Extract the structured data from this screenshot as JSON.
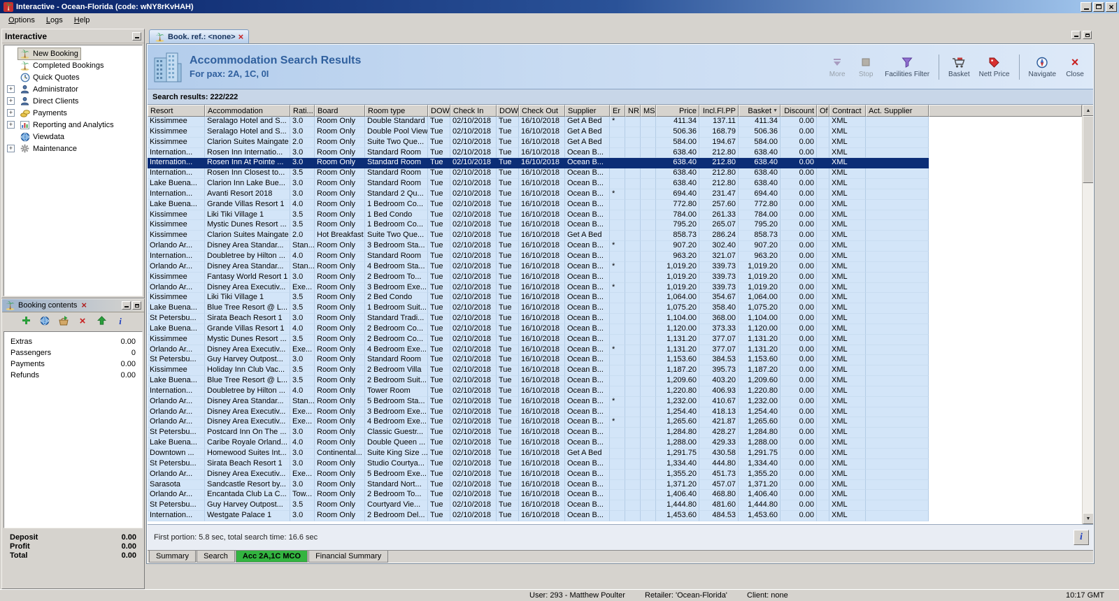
{
  "window": {
    "title": "Interactive - Ocean-Florida (code: wNY8rKvHAH)",
    "time": "10:17 GMT",
    "status_user": "User: 293 - Matthew Poulter",
    "status_retailer": "Retailer: 'Ocean-Florida'",
    "status_client": "Client: none"
  },
  "colors": {
    "selected_row": "#0b2d76",
    "active_bottom_tab": "#33b440",
    "header_text": "#30609e",
    "row_background": "#d3e5f8"
  },
  "menubar": [
    "Options",
    "Logs",
    "Help"
  ],
  "sidebar": {
    "title": "Interactive",
    "items": [
      {
        "label": "New Booking",
        "icon": "palm-tree",
        "expand": false,
        "selected": true
      },
      {
        "label": "Completed Bookings",
        "icon": "palm-tree",
        "expand": false
      },
      {
        "label": "Quick Quotes",
        "icon": "clock-globe",
        "expand": false
      },
      {
        "label": "Administrator",
        "icon": "person",
        "expand": true
      },
      {
        "label": "Direct Clients",
        "icon": "person",
        "expand": true
      },
      {
        "label": "Payments",
        "icon": "coins",
        "expand": true
      },
      {
        "label": "Reporting and Analytics",
        "icon": "chart",
        "expand": true
      },
      {
        "label": "Viewdata",
        "icon": "globe",
        "expand": false
      },
      {
        "label": "Maintenance",
        "icon": "gear",
        "expand": true
      }
    ]
  },
  "booking_contents": {
    "title": "Booking contents",
    "toolbar": [
      "add",
      "world",
      "to-basket",
      "delete",
      "move-up",
      "info"
    ],
    "items": [
      {
        "label": "Extras",
        "value": "0.00"
      },
      {
        "label": "Passengers",
        "value": "0"
      },
      {
        "label": "Payments",
        "value": "0.00"
      },
      {
        "label": "Refunds",
        "value": "0.00"
      }
    ],
    "totals": [
      {
        "label": "Deposit",
        "value": "0.00"
      },
      {
        "label": "Profit",
        "value": "0.00"
      },
      {
        "label": "Total",
        "value": "0.00"
      }
    ]
  },
  "doc_tab": {
    "label": "Book. ref.: <none>"
  },
  "header": {
    "title": "Accommodation Search Results",
    "subtitle": "For pax: 2A, 1C, 0I"
  },
  "toolbar": {
    "buttons": [
      {
        "label": "More",
        "icon": "down-arrow",
        "disabled": true
      },
      {
        "label": "Stop",
        "icon": "stop",
        "disabled": true
      },
      {
        "label": "Facilities Filter",
        "icon": "filter"
      },
      {
        "label": "Basket",
        "icon": "basket",
        "sep_before": true
      },
      {
        "label": "Nett Price",
        "icon": "nett-price"
      },
      {
        "label": "Navigate",
        "icon": "navigate",
        "sep_before": true
      },
      {
        "label": "Close",
        "icon": "close"
      }
    ]
  },
  "results": {
    "summary": "Search results: 222/222",
    "footer": "First portion: 5.8 sec, total search time: 16.6 sec"
  },
  "bottom_tabs": [
    {
      "label": "Summary"
    },
    {
      "label": "Search"
    },
    {
      "label": "Acc 2A,1C MCO",
      "active": true
    },
    {
      "label": "Financial Summary"
    }
  ],
  "table": {
    "selected_index": 4,
    "columns": [
      {
        "label": "Resort"
      },
      {
        "label": "Accommodation"
      },
      {
        "label": "Rati..."
      },
      {
        "label": "Board"
      },
      {
        "label": "Room type"
      },
      {
        "label": "DOW"
      },
      {
        "label": "Check In"
      },
      {
        "label": "DOW"
      },
      {
        "label": "Check Out"
      },
      {
        "label": "Supplier"
      },
      {
        "label": "Er"
      },
      {
        "label": "NR"
      },
      {
        "label": "MS"
      },
      {
        "label": "Price",
        "align": "right"
      },
      {
        "label": "Incl.Fl.PP",
        "align": "right"
      },
      {
        "label": "Basket",
        "align": "right",
        "sorted": true
      },
      {
        "label": "Discount",
        "align": "right"
      },
      {
        "label": "Of"
      },
      {
        "label": "Contract"
      },
      {
        "label": "Act. Supplier"
      }
    ],
    "rows": [
      [
        "Kissimmee",
        "Seralago Hotel and S...",
        "3.0",
        "Room Only",
        "Double Standard",
        "Tue",
        "02/10/2018",
        "Tue",
        "16/10/2018",
        "Get A Bed",
        "*",
        "",
        "",
        "411.34",
        "137.11",
        "411.34",
        "0.00",
        "",
        "XML",
        ""
      ],
      [
        "Kissimmee",
        "Seralago Hotel and S...",
        "3.0",
        "Room Only",
        "Double Pool View",
        "Tue",
        "02/10/2018",
        "Tue",
        "16/10/2018",
        "Get A Bed",
        "",
        "",
        "",
        "506.36",
        "168.79",
        "506.36",
        "0.00",
        "",
        "XML",
        ""
      ],
      [
        "Kissimmee",
        "Clarion Suites Maingate",
        "2.0",
        "Room Only",
        "Suite Two Que...",
        "Tue",
        "02/10/2018",
        "Tue",
        "16/10/2018",
        "Get A Bed",
        "",
        "",
        "",
        "584.00",
        "194.67",
        "584.00",
        "0.00",
        "",
        "XML",
        ""
      ],
      [
        "Internation...",
        "Rosen Inn Internatio...",
        "3.0",
        "Room Only",
        "Standard Room",
        "Tue",
        "02/10/2018",
        "Tue",
        "16/10/2018",
        "Ocean B...",
        "",
        "",
        "",
        "638.40",
        "212.80",
        "638.40",
        "0.00",
        "",
        "XML",
        ""
      ],
      [
        "Internation...",
        "Rosen Inn At Pointe ...",
        "3.0",
        "Room Only",
        "Standard Room",
        "Tue",
        "02/10/2018",
        "Tue",
        "16/10/2018",
        "Ocean B...",
        "",
        "",
        "",
        "638.40",
        "212.80",
        "638.40",
        "0.00",
        "",
        "XML",
        ""
      ],
      [
        "Internation...",
        "Rosen Inn Closest to...",
        "3.5",
        "Room Only",
        "Standard Room",
        "Tue",
        "02/10/2018",
        "Tue",
        "16/10/2018",
        "Ocean B...",
        "",
        "",
        "",
        "638.40",
        "212.80",
        "638.40",
        "0.00",
        "",
        "XML",
        ""
      ],
      [
        "Lake Buena...",
        "Clarion Inn Lake Bue...",
        "3.0",
        "Room Only",
        "Standard Room",
        "Tue",
        "02/10/2018",
        "Tue",
        "16/10/2018",
        "Ocean B...",
        "",
        "",
        "",
        "638.40",
        "212.80",
        "638.40",
        "0.00",
        "",
        "XML",
        ""
      ],
      [
        "Internation...",
        "Avanti Resort 2018",
        "3.0",
        "Room Only",
        "Standard 2 Qu...",
        "Tue",
        "02/10/2018",
        "Tue",
        "16/10/2018",
        "Ocean B...",
        "*",
        "",
        "",
        "694.40",
        "231.47",
        "694.40",
        "0.00",
        "",
        "XML",
        ""
      ],
      [
        "Lake Buena...",
        "Grande Villas Resort 1",
        "4.0",
        "Room Only",
        "1 Bedroom Co...",
        "Tue",
        "02/10/2018",
        "Tue",
        "16/10/2018",
        "Ocean B...",
        "",
        "",
        "",
        "772.80",
        "257.60",
        "772.80",
        "0.00",
        "",
        "XML",
        ""
      ],
      [
        "Kissimmee",
        "Liki Tiki Village 1",
        "3.5",
        "Room Only",
        "1 Bed Condo",
        "Tue",
        "02/10/2018",
        "Tue",
        "16/10/2018",
        "Ocean B...",
        "",
        "",
        "",
        "784.00",
        "261.33",
        "784.00",
        "0.00",
        "",
        "XML",
        ""
      ],
      [
        "Kissimmee",
        "Mystic Dunes Resort ...",
        "3.5",
        "Room Only",
        "1 Bedroom Co...",
        "Tue",
        "02/10/2018",
        "Tue",
        "16/10/2018",
        "Ocean B...",
        "",
        "",
        "",
        "795.20",
        "265.07",
        "795.20",
        "0.00",
        "",
        "XML",
        ""
      ],
      [
        "Kissimmee",
        "Clarion Suites Maingate",
        "2.0",
        "Hot Breakfast",
        "Suite Two Que...",
        "Tue",
        "02/10/2018",
        "Tue",
        "16/10/2018",
        "Get A Bed",
        "",
        "",
        "",
        "858.73",
        "286.24",
        "858.73",
        "0.00",
        "",
        "XML",
        ""
      ],
      [
        "Orlando Ar...",
        "Disney Area Standar...",
        "Stan...",
        "Room Only",
        "3 Bedroom Sta...",
        "Tue",
        "02/10/2018",
        "Tue",
        "16/10/2018",
        "Ocean B...",
        "*",
        "",
        "",
        "907.20",
        "302.40",
        "907.20",
        "0.00",
        "",
        "XML",
        ""
      ],
      [
        "Internation...",
        "Doubletree by Hilton ...",
        "4.0",
        "Room Only",
        "Standard Room",
        "Tue",
        "02/10/2018",
        "Tue",
        "16/10/2018",
        "Ocean B...",
        "",
        "",
        "",
        "963.20",
        "321.07",
        "963.20",
        "0.00",
        "",
        "XML",
        ""
      ],
      [
        "Orlando Ar...",
        "Disney Area Standar...",
        "Stan...",
        "Room Only",
        "4 Bedroom Sta...",
        "Tue",
        "02/10/2018",
        "Tue",
        "16/10/2018",
        "Ocean B...",
        "*",
        "",
        "",
        "1,019.20",
        "339.73",
        "1,019.20",
        "0.00",
        "",
        "XML",
        ""
      ],
      [
        "Kissimmee",
        "Fantasy World Resort 1",
        "3.0",
        "Room Only",
        "2 Bedroom To...",
        "Tue",
        "02/10/2018",
        "Tue",
        "16/10/2018",
        "Ocean B...",
        "",
        "",
        "",
        "1,019.20",
        "339.73",
        "1,019.20",
        "0.00",
        "",
        "XML",
        ""
      ],
      [
        "Orlando Ar...",
        "Disney Area Executiv...",
        "Exe...",
        "Room Only",
        "3 Bedroom Exe...",
        "Tue",
        "02/10/2018",
        "Tue",
        "16/10/2018",
        "Ocean B...",
        "*",
        "",
        "",
        "1,019.20",
        "339.73",
        "1,019.20",
        "0.00",
        "",
        "XML",
        ""
      ],
      [
        "Kissimmee",
        "Liki Tiki Village 1",
        "3.5",
        "Room Only",
        "2 Bed Condo",
        "Tue",
        "02/10/2018",
        "Tue",
        "16/10/2018",
        "Ocean B...",
        "",
        "",
        "",
        "1,064.00",
        "354.67",
        "1,064.00",
        "0.00",
        "",
        "XML",
        ""
      ],
      [
        "Lake Buena...",
        "Blue Tree Resort @ L...",
        "3.5",
        "Room Only",
        "1 Bedroom Suit...",
        "Tue",
        "02/10/2018",
        "Tue",
        "16/10/2018",
        "Ocean B...",
        "",
        "",
        "",
        "1,075.20",
        "358.40",
        "1,075.20",
        "0.00",
        "",
        "XML",
        ""
      ],
      [
        "St Petersbu...",
        "Sirata Beach Resort 1",
        "3.0",
        "Room Only",
        "Standard Tradi...",
        "Tue",
        "02/10/2018",
        "Tue",
        "16/10/2018",
        "Ocean B...",
        "",
        "",
        "",
        "1,104.00",
        "368.00",
        "1,104.00",
        "0.00",
        "",
        "XML",
        ""
      ],
      [
        "Lake Buena...",
        "Grande Villas Resort 1",
        "4.0",
        "Room Only",
        "2 Bedroom Co...",
        "Tue",
        "02/10/2018",
        "Tue",
        "16/10/2018",
        "Ocean B...",
        "",
        "",
        "",
        "1,120.00",
        "373.33",
        "1,120.00",
        "0.00",
        "",
        "XML",
        ""
      ],
      [
        "Kissimmee",
        "Mystic Dunes Resort ...",
        "3.5",
        "Room Only",
        "2 Bedroom Co...",
        "Tue",
        "02/10/2018",
        "Tue",
        "16/10/2018",
        "Ocean B...",
        "",
        "",
        "",
        "1,131.20",
        "377.07",
        "1,131.20",
        "0.00",
        "",
        "XML",
        ""
      ],
      [
        "Orlando Ar...",
        "Disney Area Executiv...",
        "Exe...",
        "Room Only",
        "4 Bedroom Exe...",
        "Tue",
        "02/10/2018",
        "Tue",
        "16/10/2018",
        "Ocean B...",
        "*",
        "",
        "",
        "1,131.20",
        "377.07",
        "1,131.20",
        "0.00",
        "",
        "XML",
        ""
      ],
      [
        "St Petersbu...",
        "Guy Harvey Outpost...",
        "3.0",
        "Room Only",
        "Standard Room",
        "Tue",
        "02/10/2018",
        "Tue",
        "16/10/2018",
        "Ocean B...",
        "",
        "",
        "",
        "1,153.60",
        "384.53",
        "1,153.60",
        "0.00",
        "",
        "XML",
        ""
      ],
      [
        "Kissimmee",
        "Holiday Inn Club Vac...",
        "3.5",
        "Room Only",
        "2 Bedroom Villa",
        "Tue",
        "02/10/2018",
        "Tue",
        "16/10/2018",
        "Ocean B...",
        "",
        "",
        "",
        "1,187.20",
        "395.73",
        "1,187.20",
        "0.00",
        "",
        "XML",
        ""
      ],
      [
        "Lake Buena...",
        "Blue Tree Resort @ L...",
        "3.5",
        "Room Only",
        "2 Bedroom Suit...",
        "Tue",
        "02/10/2018",
        "Tue",
        "16/10/2018",
        "Ocean B...",
        "",
        "",
        "",
        "1,209.60",
        "403.20",
        "1,209.60",
        "0.00",
        "",
        "XML",
        ""
      ],
      [
        "Internation...",
        "Doubletree by Hilton ...",
        "4.0",
        "Room Only",
        "Tower Room",
        "Tue",
        "02/10/2018",
        "Tue",
        "16/10/2018",
        "Ocean B...",
        "",
        "",
        "",
        "1,220.80",
        "406.93",
        "1,220.80",
        "0.00",
        "",
        "XML",
        ""
      ],
      [
        "Orlando Ar...",
        "Disney Area Standar...",
        "Stan...",
        "Room Only",
        "5 Bedroom Sta...",
        "Tue",
        "02/10/2018",
        "Tue",
        "16/10/2018",
        "Ocean B...",
        "*",
        "",
        "",
        "1,232.00",
        "410.67",
        "1,232.00",
        "0.00",
        "",
        "XML",
        ""
      ],
      [
        "Orlando Ar...",
        "Disney Area Executiv...",
        "Exe...",
        "Room Only",
        "3 Bedroom Exe...",
        "Tue",
        "02/10/2018",
        "Tue",
        "16/10/2018",
        "Ocean B...",
        "",
        "",
        "",
        "1,254.40",
        "418.13",
        "1,254.40",
        "0.00",
        "",
        "XML",
        ""
      ],
      [
        "Orlando Ar...",
        "Disney Area Executiv...",
        "Exe...",
        "Room Only",
        "4 Bedroom Exe...",
        "Tue",
        "02/10/2018",
        "Tue",
        "16/10/2018",
        "Ocean B...",
        "*",
        "",
        "",
        "1,265.60",
        "421.87",
        "1,265.60",
        "0.00",
        "",
        "XML",
        ""
      ],
      [
        "St Petersbu...",
        "Postcard Inn On The ...",
        "3.0",
        "Room Only",
        "Classic Guestr...",
        "Tue",
        "02/10/2018",
        "Tue",
        "16/10/2018",
        "Ocean B...",
        "",
        "",
        "",
        "1,284.80",
        "428.27",
        "1,284.80",
        "0.00",
        "",
        "XML",
        ""
      ],
      [
        "Lake Buena...",
        "Caribe Royale Orland...",
        "4.0",
        "Room Only",
        "Double Queen ...",
        "Tue",
        "02/10/2018",
        "Tue",
        "16/10/2018",
        "Ocean B...",
        "",
        "",
        "",
        "1,288.00",
        "429.33",
        "1,288.00",
        "0.00",
        "",
        "XML",
        ""
      ],
      [
        "Downtown ...",
        "Homewood Suites Int...",
        "3.0",
        "Continental...",
        "Suite King Size ...",
        "Tue",
        "02/10/2018",
        "Tue",
        "16/10/2018",
        "Get A Bed",
        "",
        "",
        "",
        "1,291.75",
        "430.58",
        "1,291.75",
        "0.00",
        "",
        "XML",
        ""
      ],
      [
        "St Petersbu...",
        "Sirata Beach Resort 1",
        "3.0",
        "Room Only",
        "Studio Courtya...",
        "Tue",
        "02/10/2018",
        "Tue",
        "16/10/2018",
        "Ocean B...",
        "",
        "",
        "",
        "1,334.40",
        "444.80",
        "1,334.40",
        "0.00",
        "",
        "XML",
        ""
      ],
      [
        "Orlando Ar...",
        "Disney Area Executiv...",
        "Exe...",
        "Room Only",
        "5 Bedroom Exe...",
        "Tue",
        "02/10/2018",
        "Tue",
        "16/10/2018",
        "Ocean B...",
        "",
        "",
        "",
        "1,355.20",
        "451.73",
        "1,355.20",
        "0.00",
        "",
        "XML",
        ""
      ],
      [
        "Sarasota",
        "Sandcastle Resort by...",
        "3.0",
        "Room Only",
        "Standard Nort...",
        "Tue",
        "02/10/2018",
        "Tue",
        "16/10/2018",
        "Ocean B...",
        "",
        "",
        "",
        "1,371.20",
        "457.07",
        "1,371.20",
        "0.00",
        "",
        "XML",
        ""
      ],
      [
        "Orlando Ar...",
        "Encantada Club La C...",
        "Tow...",
        "Room Only",
        "2 Bedroom To...",
        "Tue",
        "02/10/2018",
        "Tue",
        "16/10/2018",
        "Ocean B...",
        "",
        "",
        "",
        "1,406.40",
        "468.80",
        "1,406.40",
        "0.00",
        "",
        "XML",
        ""
      ],
      [
        "St Petersbu...",
        "Guy Harvey Outpost...",
        "3.5",
        "Room Only",
        "Courtyard Vie...",
        "Tue",
        "02/10/2018",
        "Tue",
        "16/10/2018",
        "Ocean B...",
        "",
        "",
        "",
        "1,444.80",
        "481.60",
        "1,444.80",
        "0.00",
        "",
        "XML",
        ""
      ],
      [
        "Internation...",
        "Westgate Palace 1",
        "3.0",
        "Room Only",
        "2 Bedroom Del...",
        "Tue",
        "02/10/2018",
        "Tue",
        "16/10/2018",
        "Ocean B...",
        "",
        "",
        "",
        "1,453.60",
        "484.53",
        "1,453.60",
        "0.00",
        "",
        "XML",
        ""
      ]
    ]
  }
}
